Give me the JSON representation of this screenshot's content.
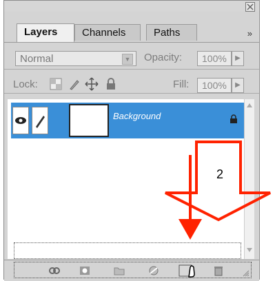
{
  "tabs": [
    "Layers",
    "Channels",
    "Paths"
  ],
  "menu": "»",
  "blend_mode": "Normal",
  "opacity_label": "Opacity:",
  "opacity_value": "100%",
  "lock_label": "Lock:",
  "fill_label": "Fill:",
  "fill_value": "100%",
  "layer_name": "Background",
  "annotation_number": "2"
}
